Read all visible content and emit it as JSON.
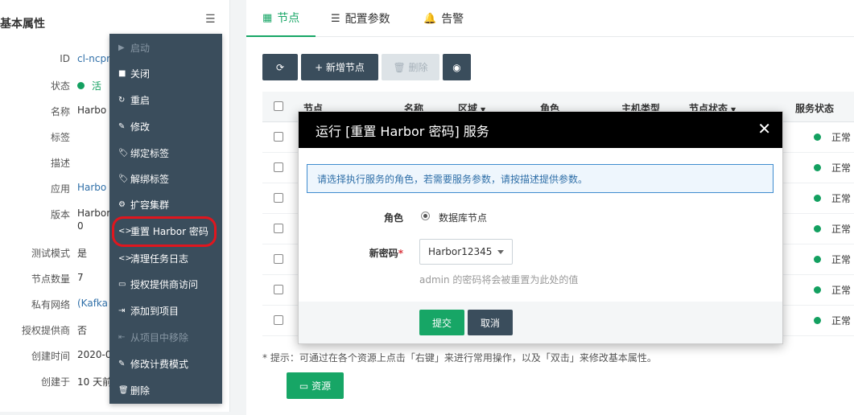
{
  "left_panel": {
    "title": "基本属性",
    "menu_icon": "☰",
    "properties": [
      {
        "label": "ID",
        "value": "cl-ncpr",
        "kind": "link"
      },
      {
        "label": "状态",
        "value": "活",
        "kind": "status"
      },
      {
        "label": "名称",
        "value": "Harbo",
        "kind": "text"
      },
      {
        "label": "标签",
        "value": "",
        "kind": "text"
      },
      {
        "label": "描述",
        "value": "",
        "kind": "text"
      },
      {
        "label": "应用",
        "value": "Harbo",
        "kind": "link"
      },
      {
        "label": "版本",
        "value": "Harbor",
        "value2": "0",
        "kind": "text"
      },
      {
        "label": "测试模式",
        "value": "是",
        "kind": "text"
      },
      {
        "label": "节点数量",
        "value": "7",
        "kind": "text"
      },
      {
        "label": "私有网络",
        "value": "(Kafka",
        "kind": "link"
      },
      {
        "label": "授权提供商",
        "value": "否",
        "kind": "text"
      },
      {
        "label": "创建时间",
        "value": "2020-0",
        "kind": "text"
      },
      {
        "label": "创建于",
        "value": "10 天前",
        "kind": "text"
      }
    ]
  },
  "context_menu": {
    "items": [
      {
        "label": "启动",
        "icon": "▶",
        "disabled": true
      },
      {
        "label": "关闭",
        "icon": "■",
        "disabled": false
      },
      {
        "label": "重启",
        "icon": "↻",
        "disabled": false
      },
      {
        "label": "修改",
        "icon": "✎",
        "disabled": false
      },
      {
        "label": "绑定标签",
        "icon": "🏷",
        "disabled": false
      },
      {
        "label": "解绑标签",
        "icon": "🏷",
        "disabled": false
      },
      {
        "label": "扩容集群",
        "icon": "⚙",
        "disabled": false
      },
      {
        "label": "重置 Harbor 密码",
        "icon": "<>",
        "disabled": false
      },
      {
        "label": "清理任务日志",
        "icon": "<>",
        "disabled": false
      },
      {
        "label": "授权提供商访问",
        "icon": "▭",
        "disabled": false
      },
      {
        "label": "添加到项目",
        "icon": "⇥",
        "disabled": false
      },
      {
        "label": "从项目中移除",
        "icon": "⇤",
        "disabled": true
      },
      {
        "label": "修改计费模式",
        "icon": "✎",
        "disabled": false
      },
      {
        "label": "删除",
        "icon": "🗑",
        "disabled": false
      }
    ]
  },
  "tabs": [
    {
      "label": "节点",
      "icon": "▦",
      "active": true
    },
    {
      "label": "配置参数",
      "icon": "☰",
      "active": false
    },
    {
      "label": "告警",
      "icon": "🔔",
      "active": false
    }
  ],
  "toolbar": {
    "refresh_icon": "⟳",
    "add_label": "+ 新增节点",
    "delete_label": "🗑 删除",
    "eye_icon": "◉"
  },
  "table": {
    "columns": [
      "节点",
      "名称",
      "区域",
      "角色",
      "主机类型",
      "节点状态",
      "服务状态"
    ],
    "sortable": [
      "区域",
      "节点状态"
    ],
    "rows": [
      {
        "service_status": "正常"
      },
      {
        "service_status": "正常"
      },
      {
        "service_status": "正常"
      },
      {
        "service_status": "正常"
      },
      {
        "service_status": "正常"
      },
      {
        "service_status": "正常"
      },
      {
        "service_status": "正常"
      }
    ]
  },
  "hint": "* 提示：可通过在各个资源上点击「右键」来进行常用操作，以及「双击」来修改基本属性。",
  "resource_button": "▭ 资源",
  "modal": {
    "title": "运行 [重置 Harbor 密码] 服务",
    "close": "✕",
    "info": "请选择执行服务的角色，若需要服务参数，请按描述提供参数。",
    "role_label": "角色",
    "role_value": "数据库节点",
    "password_label": "新密码",
    "password_required": "*",
    "password_value": "Harbor12345",
    "password_help": "admin 的密码将会被重置为此处的值",
    "submit": "提交",
    "cancel": "取消"
  },
  "colors": {
    "accent_green": "#17a666",
    "dark_slate": "#3a4d5c",
    "highlight_ring": "#e0161e",
    "info_blue": "#3f8ccf"
  }
}
